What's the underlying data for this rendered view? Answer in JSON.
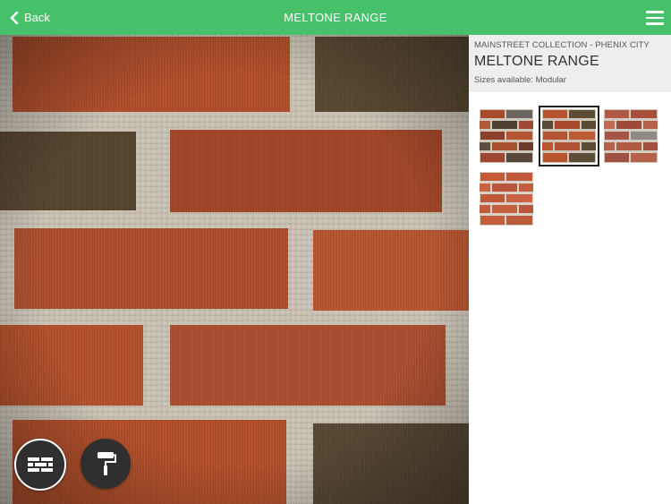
{
  "header": {
    "back_label": "Back",
    "title": "MELTONE RANGE"
  },
  "product": {
    "collection": "MAINSTREET COLLECTION - PHENIX CITY",
    "name": "MELTONE RANGE",
    "sizes": "Sizes available: Modular"
  },
  "swatches": [
    {
      "variant": "mixed-range",
      "selected": false
    },
    {
      "variant": "meltone-range",
      "selected": true
    },
    {
      "variant": "red-gray-range",
      "selected": false
    },
    {
      "variant": "red-range",
      "selected": false
    }
  ],
  "tools": {
    "brick": {
      "icon": "brick-icon",
      "active": true
    },
    "paint": {
      "icon": "paint-roller-icon",
      "active": false
    }
  },
  "colors": {
    "accent": "#47c16a",
    "mortar": "#c9c2b5",
    "brick_red": "#b5532e",
    "brick_dark": "#5a4a35",
    "tool_bg": "#2f2f2f"
  }
}
